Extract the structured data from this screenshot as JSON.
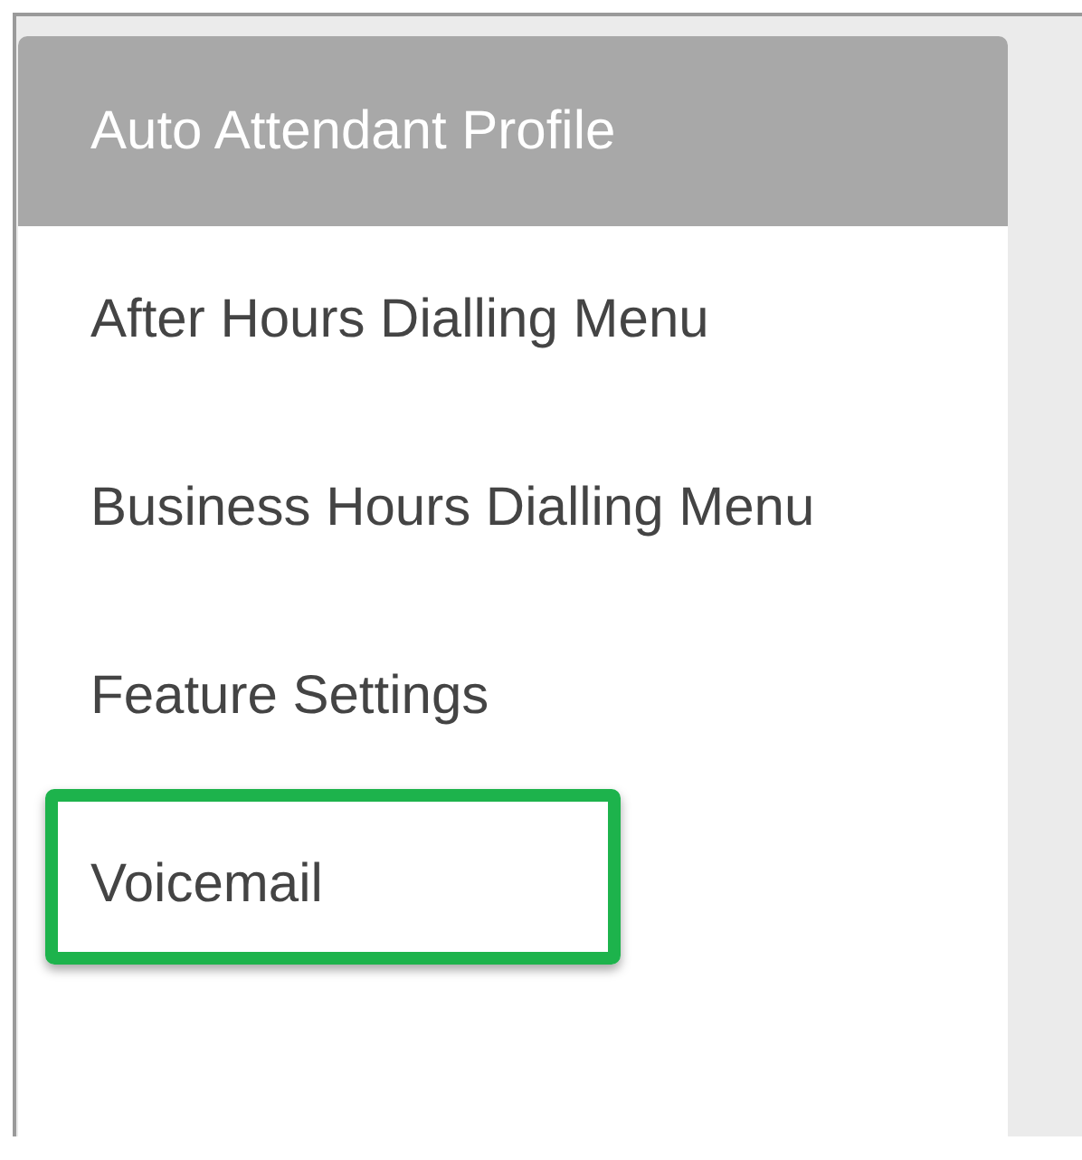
{
  "sidebar": {
    "title": "Auto Attendant Profile",
    "items": [
      {
        "label": "After Hours Dialling Menu",
        "highlighted": false
      },
      {
        "label": "Business Hours Dialling Menu",
        "highlighted": false
      },
      {
        "label": "Feature Settings",
        "highlighted": false
      },
      {
        "label": "Voicemail",
        "highlighted": true
      }
    ]
  }
}
